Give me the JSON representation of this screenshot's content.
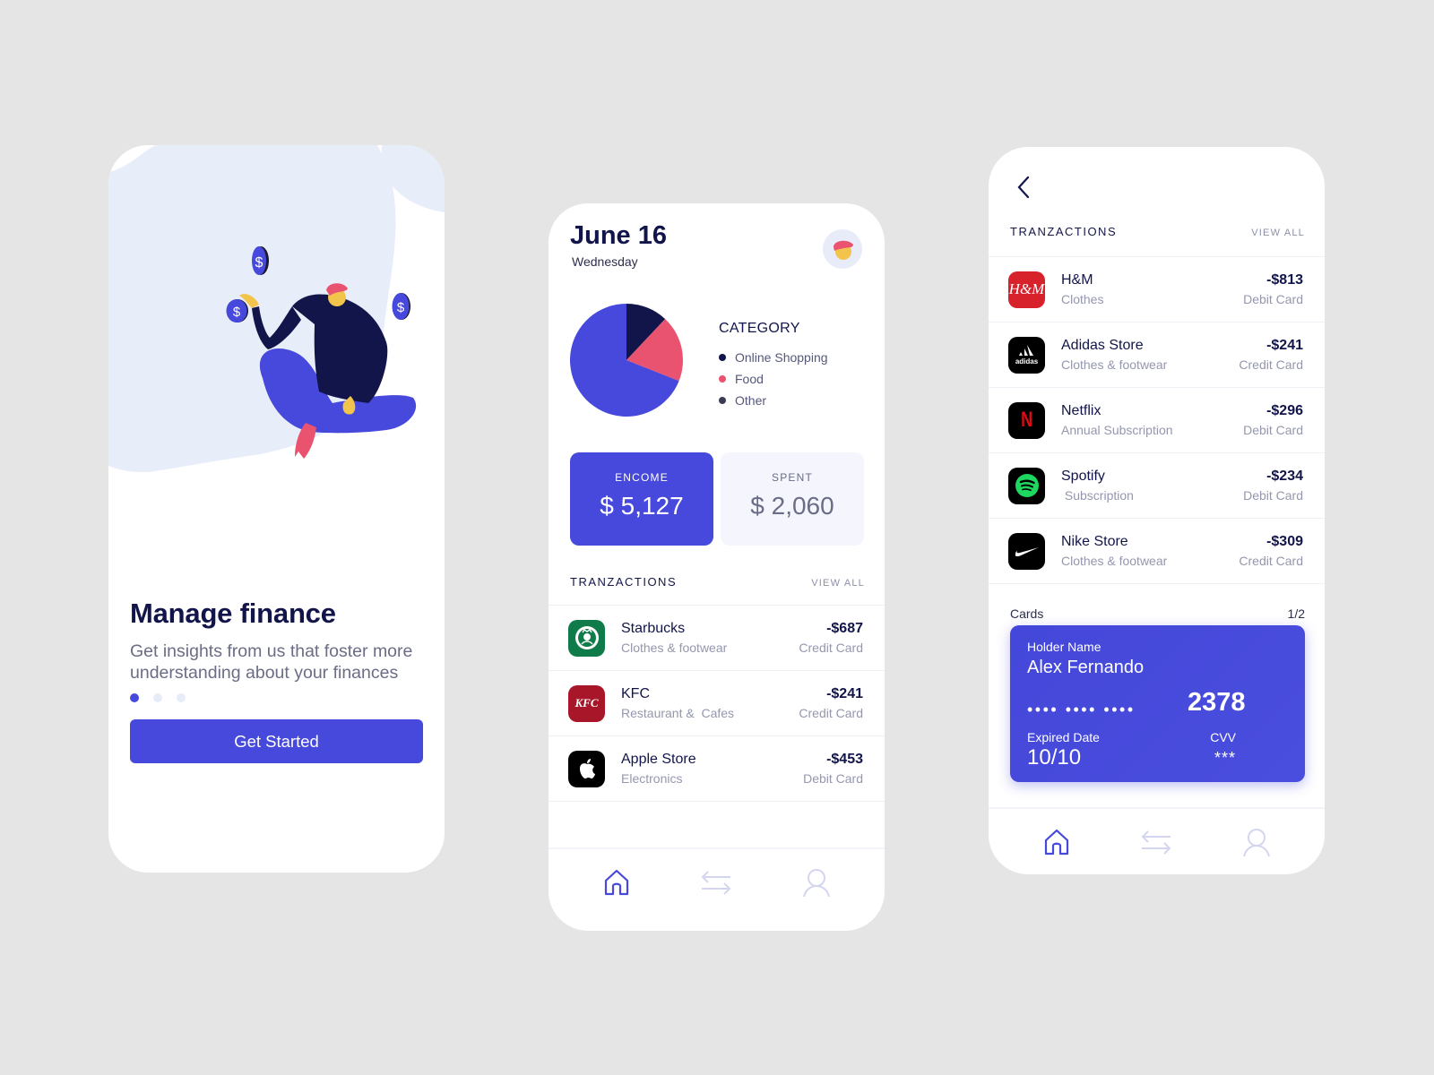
{
  "colors": {
    "primary": "#4649db",
    "navy": "#12154a",
    "pink": "#e9536f",
    "muted": "#9497ad",
    "blob": "#e8eef9",
    "background": "#e5e5e5"
  },
  "onboarding": {
    "title": "Manage finance",
    "subtitle": "Get insights from us that foster more understanding about your finances",
    "pager": {
      "current": 1,
      "total": 3
    },
    "cta_label": "Get Started",
    "illustration": "person-juggling-coins-illustration"
  },
  "dashboard": {
    "date": "June 16",
    "weekday": "Wednesday",
    "avatar_icon": "user-avatar",
    "category_title": "CATEGORY",
    "chart_data": {
      "type": "pie",
      "title": "CATEGORY",
      "legend_position": "right",
      "labels": [
        "Online Shopping",
        "Food",
        "Other"
      ],
      "values": [
        12,
        19,
        69
      ],
      "colors": [
        "#12154a",
        "#e9536f",
        "#4649db"
      ]
    },
    "legend": [
      {
        "label": "Online Shopping",
        "color": "#12154a"
      },
      {
        "label": "Food",
        "color": "#e9536f"
      },
      {
        "label": "Other",
        "color": "#3a3d52"
      }
    ],
    "income": {
      "label": "ENCOME",
      "value": "$ 5,127"
    },
    "spent": {
      "label": "SPENT",
      "value": "$ 2,060"
    },
    "transactions_title": "TRANZACTIONS",
    "view_all": "VIEW ALL",
    "transactions": [
      {
        "name": "Starbucks",
        "category": "Clothes & footwear",
        "amount": "-$687",
        "method": "Credit Card",
        "logo": "starbucks-logo"
      },
      {
        "name": "KFC",
        "category": "Restaurant &  Cafes",
        "amount": "-$241",
        "method": "Credit Card",
        "logo": "kfc-logo",
        "logo_text": "KFC"
      },
      {
        "name": "Apple Store",
        "category": "Electronics",
        "amount": "-$453",
        "method": "Debit Card",
        "logo": "apple-logo"
      }
    ],
    "tabs": [
      {
        "name": "home",
        "icon": "home-icon",
        "active": true
      },
      {
        "name": "transfers",
        "icon": "transfer-arrows-icon",
        "active": false
      },
      {
        "name": "profile",
        "icon": "user-icon",
        "active": false
      }
    ]
  },
  "transactions_screen": {
    "back_icon": "chevron-left-icon",
    "title": "TRANZACTIONS",
    "view_all": "VIEW ALL",
    "transactions": [
      {
        "name": "H&M",
        "category": "Clothes",
        "amount": "-$813",
        "method": "Debit Card",
        "logo": "hm-logo",
        "logo_text": "H&M"
      },
      {
        "name": "Adidas Store",
        "category": "Clothes & footwear",
        "amount": "-$241",
        "method": "Credit Card",
        "logo": "adidas-logo",
        "logo_text": "adidas"
      },
      {
        "name": "Netflix",
        "category": "Annual Subscription",
        "amount": "-$296",
        "method": "Debit Card",
        "logo": "netflix-logo",
        "logo_text": "N"
      },
      {
        "name": "Spotify",
        "category": " Subscription",
        "amount": "-$234",
        "method": "Debit Card",
        "logo": "spotify-logo"
      },
      {
        "name": "Nike Store",
        "category": "Clothes & footwear",
        "amount": "-$309",
        "method": "Credit Card",
        "logo": "nike-logo"
      }
    ],
    "cards_label": "Cards",
    "cards_pager": "1/2",
    "card": {
      "holder_label": "Holder Name",
      "holder_name": "Alex Fernando",
      "masked": "•••• •••• ••••",
      "last4": "2378",
      "expiry_label": "Expired Date",
      "expiry": "10/10",
      "cvv_label": "CVV",
      "cvv": "***"
    },
    "tabs": [
      {
        "name": "home",
        "icon": "home-icon",
        "active": true
      },
      {
        "name": "transfers",
        "icon": "transfer-arrows-icon",
        "active": false
      },
      {
        "name": "profile",
        "icon": "user-icon",
        "active": false
      }
    ]
  }
}
